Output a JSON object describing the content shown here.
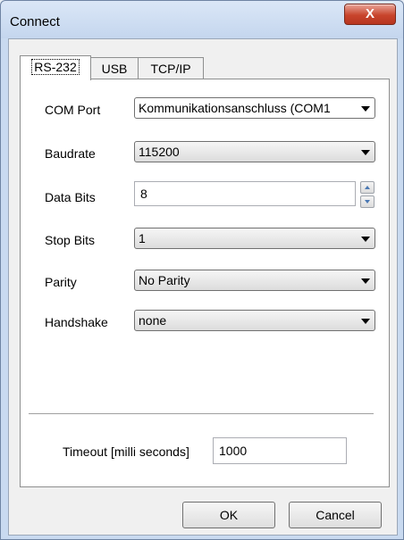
{
  "window": {
    "title": "Connect",
    "close_glyph": "X"
  },
  "tabs": [
    {
      "label": "RS-232",
      "active": true
    },
    {
      "label": "USB",
      "active": false
    },
    {
      "label": "TCP/IP",
      "active": false
    }
  ],
  "fields": {
    "com_port": {
      "label": "COM Port",
      "value": "Kommunikationsanschluss (COM1"
    },
    "baudrate": {
      "label": "Baudrate",
      "value": "115200"
    },
    "data_bits": {
      "label": "Data Bits",
      "value": "8"
    },
    "stop_bits": {
      "label": "Stop Bits",
      "value": "1"
    },
    "parity": {
      "label": "Parity",
      "value": "No Parity"
    },
    "handshake": {
      "label": "Handshake",
      "value": "none"
    }
  },
  "timeout": {
    "label": "Timeout [milli seconds]",
    "value": "1000"
  },
  "buttons": {
    "ok": "OK",
    "cancel": "Cancel"
  }
}
